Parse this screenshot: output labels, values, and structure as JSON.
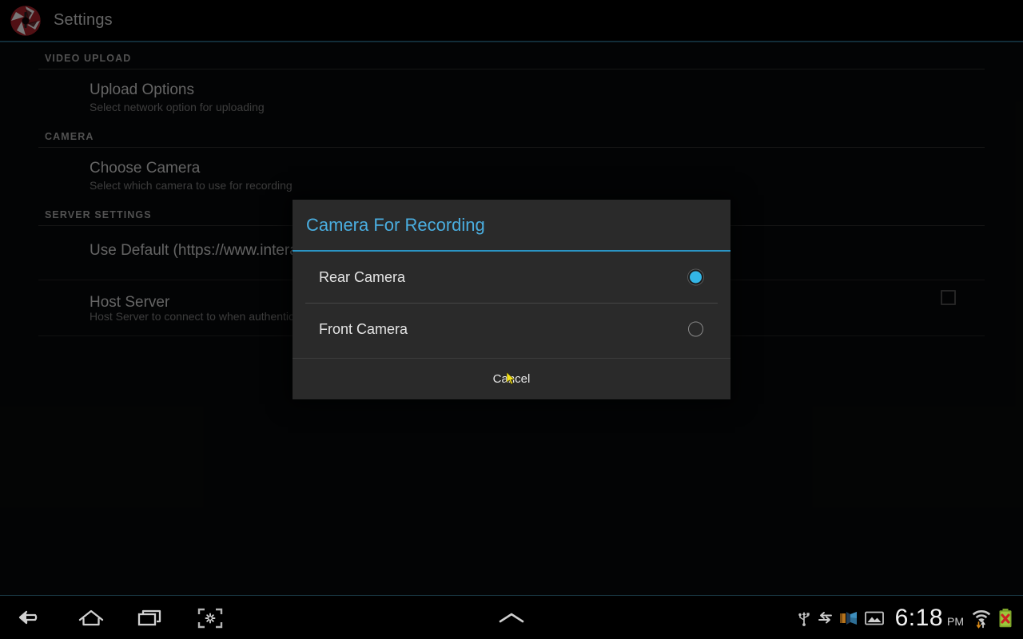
{
  "app": {
    "title": "Settings",
    "icon": "camera-aperture-icon",
    "accent_color": "#33b5e5",
    "background_color": "#050607"
  },
  "settings_list": {
    "sections": [
      {
        "header": "VIDEO UPLOAD",
        "items": [
          {
            "title": "Upload Options",
            "subtitle": "Select network option for uploading"
          }
        ]
      },
      {
        "header": "CAMERA",
        "items": [
          {
            "title": "Choose Camera",
            "subtitle": "Select which camera to use for recording"
          }
        ]
      },
      {
        "header": "SERVER SETTINGS",
        "items": [
          {
            "title": "Use Default (https://www.intera",
            "subtitle": "",
            "control": "checkbox",
            "checked": false
          },
          {
            "title": "Host Server",
            "subtitle": "Host Server to connect to when authentica"
          }
        ]
      }
    ]
  },
  "dialog": {
    "title": "Camera For Recording",
    "title_color": "#4aaee0",
    "options": [
      {
        "label": "Rear Camera",
        "selected": true
      },
      {
        "label": "Front Camera",
        "selected": false
      }
    ],
    "cancel_label": "Cancel"
  },
  "navbar": {
    "buttons": [
      {
        "name": "back",
        "label": "Back"
      },
      {
        "name": "home",
        "label": "Home"
      },
      {
        "name": "recents",
        "label": "Recent apps"
      },
      {
        "name": "screenshot",
        "label": "Screenshot"
      }
    ],
    "expand_handle": "chevron-up-icon",
    "status_icons": [
      "usb-icon",
      "sync-transfer-icon",
      "projector-cast-icon",
      "gallery-image-icon"
    ],
    "clock": {
      "time": "6:18",
      "ampm": "PM"
    },
    "signal_icons": [
      "wifi-signal-icon",
      "battery-error-icon"
    ]
  }
}
